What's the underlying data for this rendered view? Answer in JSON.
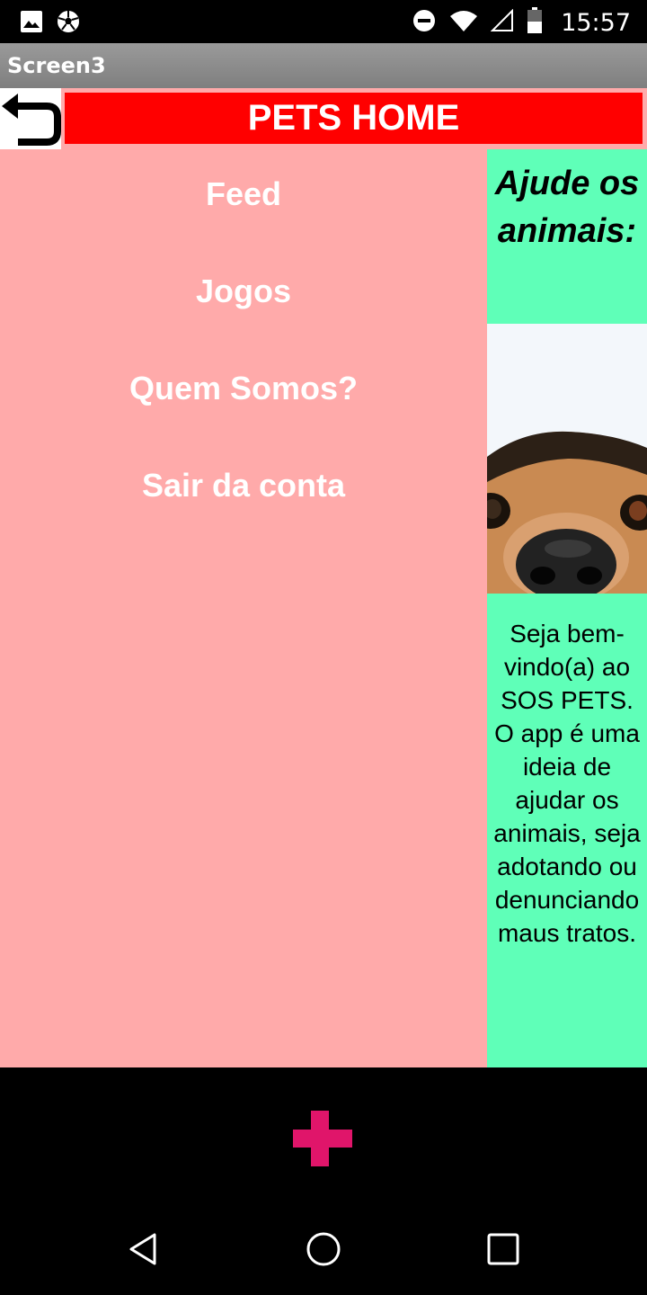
{
  "status_bar": {
    "time": "15:57",
    "left_icons": [
      "image-icon",
      "soccer-ball-icon"
    ],
    "right_icons": [
      "do-not-disturb-icon",
      "wifi-icon",
      "signal-icon",
      "battery-icon"
    ]
  },
  "app_bar": {
    "title": "Screen3"
  },
  "header": {
    "back_icon": "back-arrow-icon",
    "brand": "PETS HOME",
    "brand_color": "#ff0000"
  },
  "menu": {
    "items": [
      {
        "label": "Feed"
      },
      {
        "label": "Jogos"
      },
      {
        "label": "Quem Somos?"
      },
      {
        "label": "Sair da conta"
      }
    ],
    "background": "#ffaaaa"
  },
  "side_panel": {
    "title": "Ajude os animais:",
    "photo": "dog-peeking-photo",
    "text": "Seja bem-vindo(a) ao SOS PETS. O app é uma ideia de ajudar os animais, seja adotando ou denunciando maus tratos.",
    "background": "#5fffb8"
  },
  "fab": {
    "icon": "plus-icon",
    "color": "#e0156a"
  },
  "nav_bar": {
    "buttons": [
      "back-triangle-icon",
      "home-circle-icon",
      "recents-square-icon"
    ]
  }
}
